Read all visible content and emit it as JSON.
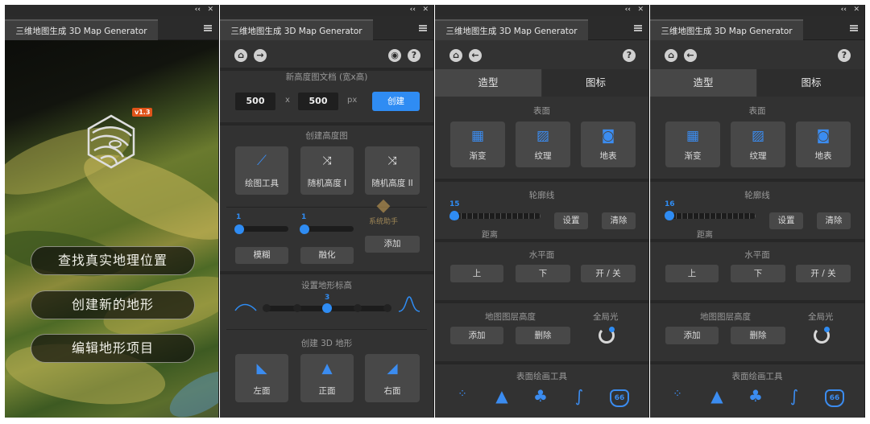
{
  "window": {
    "collapse_glyph": "‹‹",
    "close_glyph": "✕",
    "tab_title": "三维地图生成 3D Map Generator"
  },
  "home": {
    "version_badge": "v1.3",
    "buttons": [
      "查找真实地理位置",
      "创建新的地形",
      "编辑地形项目"
    ]
  },
  "create": {
    "nav_icons": [
      "home-icon",
      "forward-icon",
      "globe-icon",
      "help-icon"
    ],
    "new_doc_label": "新高度图文档 (宽x高)",
    "width_value": "500",
    "x_label": "x",
    "height_value": "500",
    "unit_label": "px",
    "create_button": "创建",
    "heightmap_label": "创建高度图",
    "tools": [
      {
        "label": "绘图工具",
        "icon": "brush-icon"
      },
      {
        "label": "随机高度 I",
        "icon": "shuffle-icon"
      },
      {
        "label": "随机高度 II",
        "icon": "shuffle-icon"
      }
    ],
    "blur_value": "1",
    "melt_value": "1",
    "blur_button": "模糊",
    "melt_button": "融化",
    "add_button": "添加",
    "watermark": "系统助手",
    "elevation_label": "设置地形标高",
    "elevation_value": "3",
    "elevation_level": 3,
    "elevation_steps": 5,
    "create3d_label": "创建 3D 地形",
    "views": [
      {
        "label": "左面",
        "icon": "left-view-icon"
      },
      {
        "label": "正面",
        "icon": "front-view-icon"
      },
      {
        "label": "右面",
        "icon": "right-view-icon"
      }
    ]
  },
  "editor_a": {
    "tabs": [
      "造型",
      "图标"
    ],
    "surface_label": "表面",
    "surface_buttons": [
      "渐变",
      "纹理",
      "地表"
    ],
    "contour_label": "轮廓线",
    "contour_value": "15",
    "distance_label": "距离",
    "set_button": "设置",
    "clear_button": "清除",
    "horizontal_label": "水平面",
    "up_button": "上",
    "down_button": "下",
    "toggle_button": "开 / 关",
    "layer_height_label": "地图图层高度",
    "global_light_label": "全局光",
    "add_button": "添加",
    "delete_button": "删除",
    "paint_tools_label": "表面绘画工具",
    "road_badge": "66"
  },
  "editor_b": {
    "tabs": [
      "造型",
      "图标"
    ],
    "surface_label": "表面",
    "surface_buttons": [
      "渐变",
      "纹理",
      "地表"
    ],
    "contour_label": "轮廓线",
    "contour_value": "16",
    "distance_label": "距离",
    "set_button": "设置",
    "clear_button": "清除",
    "horizontal_label": "水平面",
    "up_button": "上",
    "down_button": "下",
    "toggle_button": "开 / 关",
    "layer_height_label": "地图图层高度",
    "global_light_label": "全局光",
    "add_button": "添加",
    "delete_button": "删除",
    "paint_tools_label": "表面绘画工具",
    "road_badge": "66"
  },
  "colors": {
    "accent": "#2f8cf3",
    "panel": "#323232",
    "button": "#484848",
    "badge": "#e0541a"
  }
}
